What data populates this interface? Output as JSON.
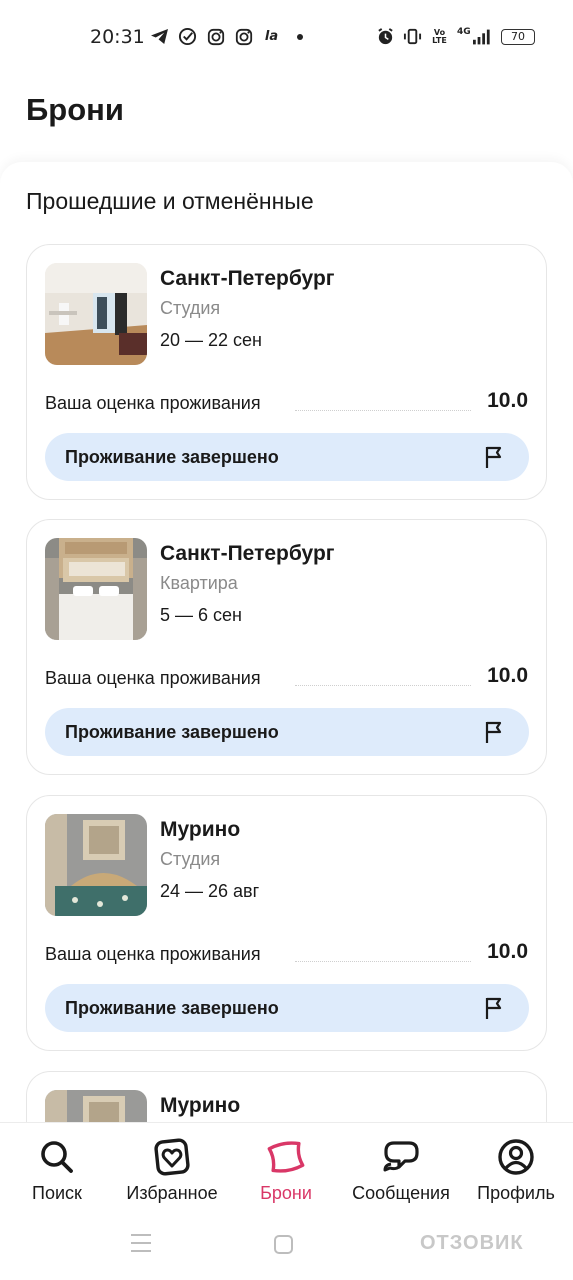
{
  "status_bar": {
    "time": "20:31",
    "left_icons": [
      "telegram-icon",
      "check-circle-icon",
      "instagram-icon",
      "instagram-icon",
      "la-icon",
      "dot-icon"
    ],
    "right_icons": [
      "alarm-icon",
      "vibrate-icon",
      "volte-icon",
      "signal-4g-icon"
    ],
    "volte": "Vo\nLTE",
    "network": "4G",
    "battery": "70"
  },
  "page_title": "Брони",
  "section_title": "Прошедшие и отменённые",
  "bookings": [
    {
      "city": "Санкт-Петербург",
      "type": "Студия",
      "dates": "20 — 22 сен",
      "rating_label": "Ваша оценка проживания",
      "rating": "10.0",
      "status": "Проживание завершено"
    },
    {
      "city": "Санкт-Петербург",
      "type": "Квартира",
      "dates": "5 — 6 сен",
      "rating_label": "Ваша оценка проживания",
      "rating": "10.0",
      "status": "Проживание завершено"
    },
    {
      "city": "Мурино",
      "type": "Студия",
      "dates": "24 — 26 авг",
      "rating_label": "Ваша оценка проживания",
      "rating": "10.0",
      "status": "Проживание завершено"
    },
    {
      "city": "Мурино"
    }
  ],
  "bottom_nav": {
    "items": [
      {
        "label": "Поиск",
        "icon": "search-icon"
      },
      {
        "label": "Избранное",
        "icon": "heart-icon"
      },
      {
        "label": "Брони",
        "icon": "pillow-icon",
        "active": true
      },
      {
        "label": "Сообщения",
        "icon": "chat-icon"
      },
      {
        "label": "Профиль",
        "icon": "profile-icon"
      }
    ]
  },
  "watermark": "ОТЗОВИК",
  "colors": {
    "accent": "#d93767",
    "pill_bg": "#deebfb",
    "muted_text": "#8a8a8a"
  }
}
